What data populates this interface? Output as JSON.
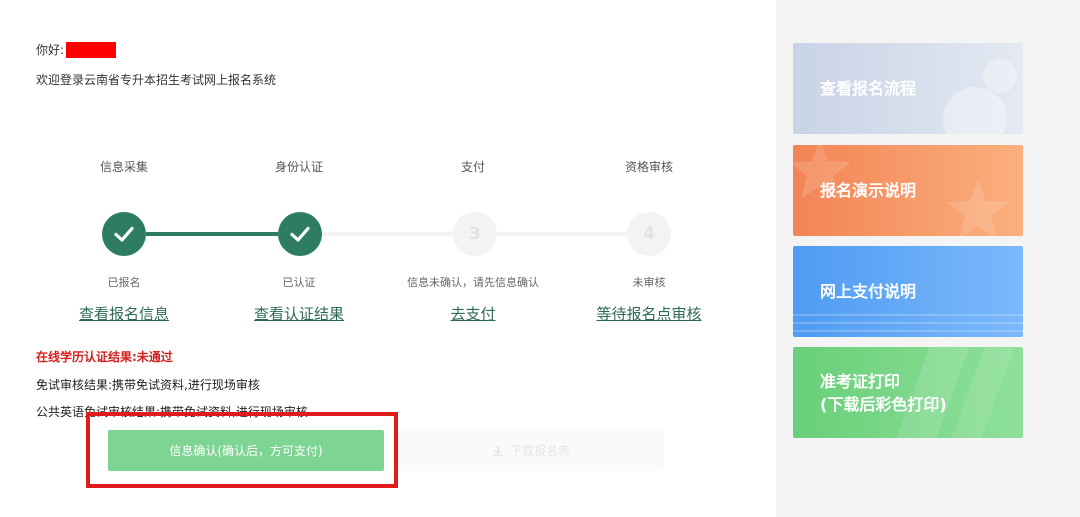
{
  "header": {
    "greeting": "你好:",
    "welcome": "欢迎登录云南省专升本招生考试网上报名系统"
  },
  "steps": [
    {
      "title": "信息采集",
      "status": "已报名",
      "link": "查看报名信息",
      "number": "",
      "done": true
    },
    {
      "title": "身份认证",
      "status": "已认证",
      "link": "查看认证结果",
      "number": "",
      "done": true
    },
    {
      "title": "支付",
      "status": "信息未确认，请先信息确认",
      "link": "去支付",
      "number": "3",
      "done": false
    },
    {
      "title": "资格审核",
      "status": "未审核",
      "link": "等待报名点审核",
      "number": "4",
      "done": false
    }
  ],
  "results": {
    "online_education": "在线学历认证结果:未通过",
    "exemption": "免试审核结果:携带免试资料,进行现场审核",
    "english_exemption": "公共英语免试审核结果:携带免试资料,进行现场审核"
  },
  "buttons": {
    "confirm": "信息确认(确认后，方可支付)",
    "download": "下载报名表"
  },
  "sidebar": {
    "cards": [
      {
        "label": "查看报名流程"
      },
      {
        "label": "报名演示说明"
      },
      {
        "label": "网上支付说明"
      },
      {
        "label_line1": "准考证打印",
        "label_line2": "(下载后彩色打印)"
      }
    ]
  },
  "colors": {
    "step_done": "#2e7d62",
    "confirm_button": "#7ed492",
    "fail_text": "#d32222",
    "highlight_border": "#e01b1b"
  }
}
